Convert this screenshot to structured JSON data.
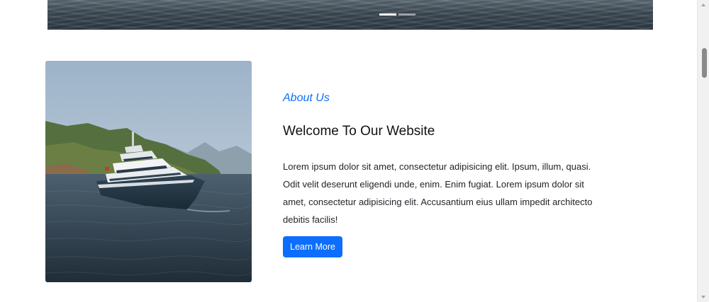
{
  "hero": {
    "slides_count": 2,
    "active_slide": 1
  },
  "about": {
    "eyebrow": "About Us",
    "title": "Welcome To Our Website",
    "body": "Lorem ipsum dolor sit amet, consectetur adipisicing elit. Ipsum, illum, quasi. Odit velit deserunt eligendi unde, enim. Enim fugiat. Lorem ipsum dolor sit amet, consectetur adipisicing elit. Accusantium eius ullam impedit architecto debitis facilis!",
    "button_label": "Learn More",
    "image_icon": "yacht-photo"
  },
  "colors": {
    "accent": "#0d6efd",
    "title": "#111111",
    "text": "#212529"
  }
}
